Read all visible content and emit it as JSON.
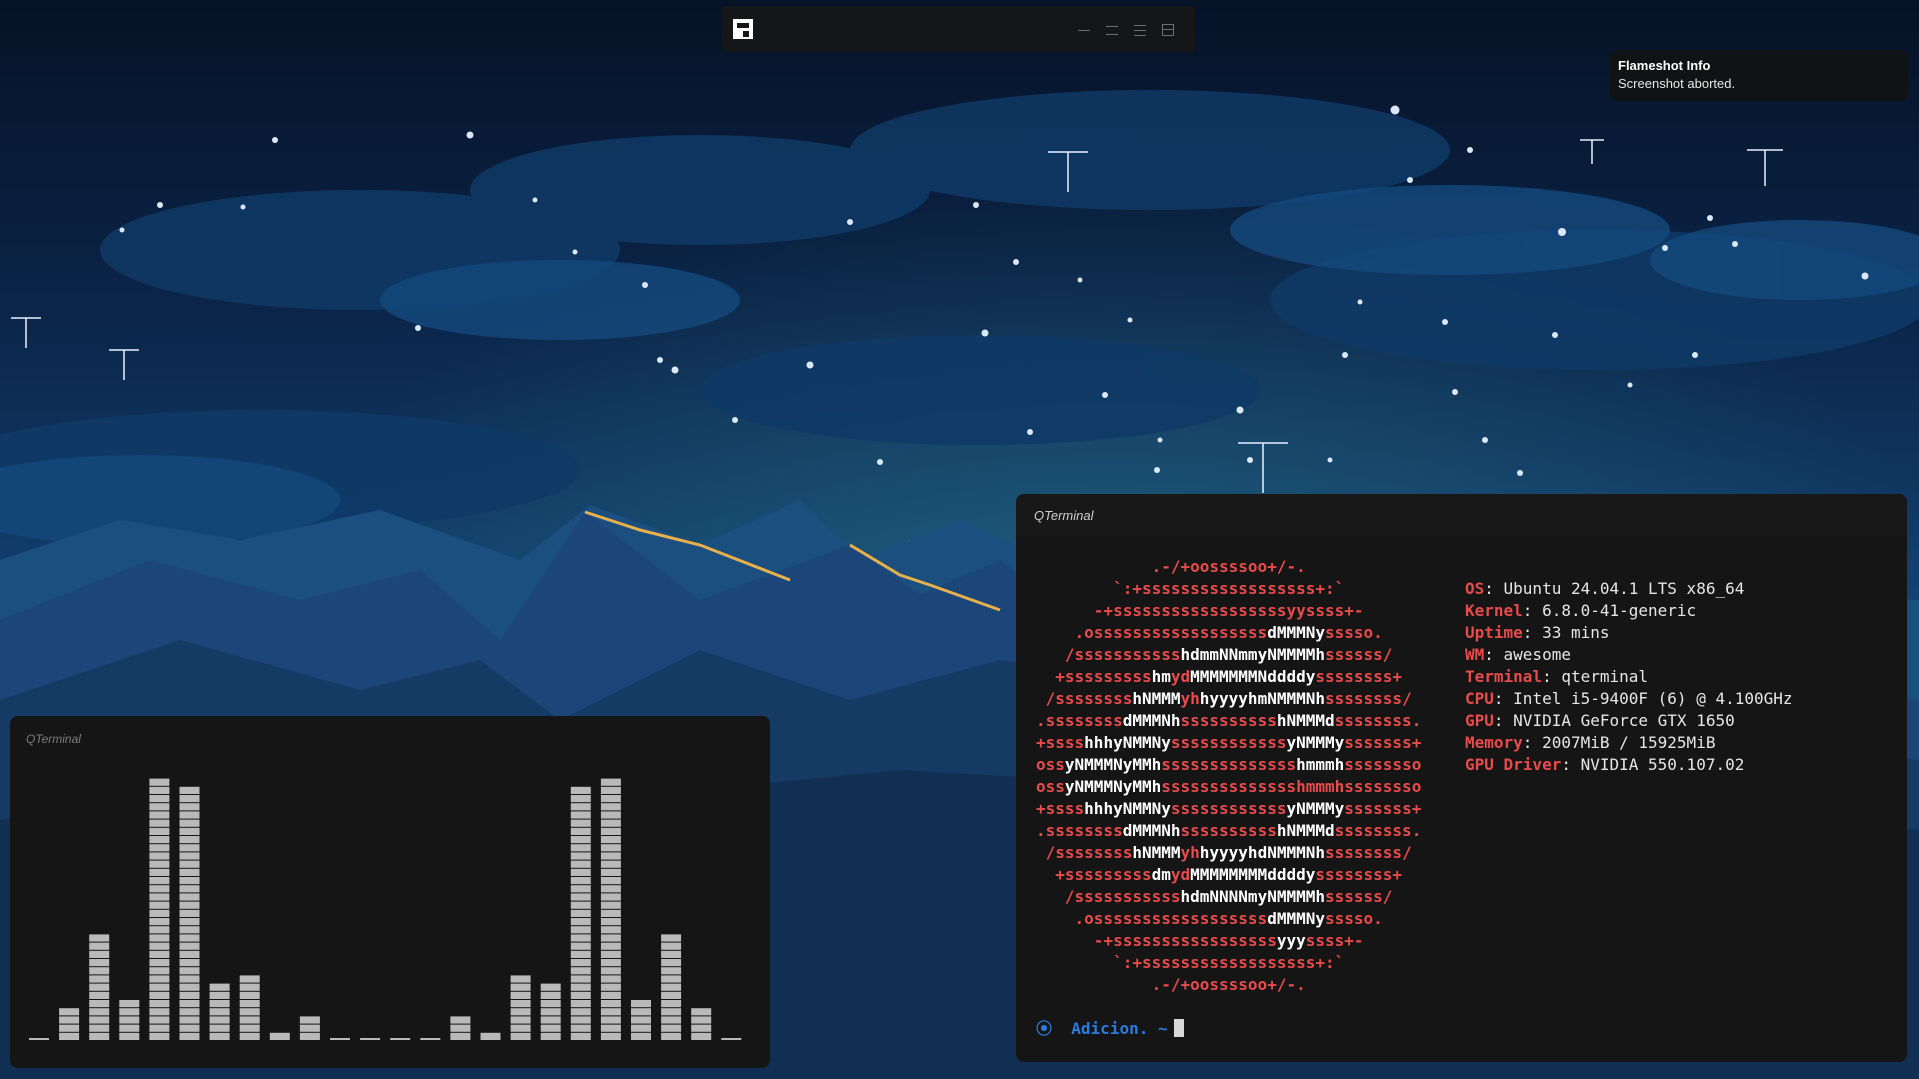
{
  "desktop": {
    "wallpaper": "night-sky-mountains",
    "colors": {
      "sky_top": "#061226",
      "sky_mid": "#12406e",
      "mountain": "#1c4f82",
      "ridge_glow": "#e8b04a"
    }
  },
  "wibar": {
    "launcher_icon": "awesome-launcher-icon",
    "layout_icons": [
      "tile-layout-icon",
      "fair-layout-icon",
      "max-layout-icon",
      "floating-layout-icon"
    ]
  },
  "notification": {
    "title": "Flameshot Info",
    "body": "Screenshot aborted."
  },
  "visualizer_terminal": {
    "title": "QTerminal",
    "bar_levels": [
      0,
      0.11,
      0.41,
      0.15,
      1.0,
      0.95,
      0.22,
      0.25,
      0.03,
      0.08,
      0,
      0,
      0,
      0,
      0.08,
      0.03,
      0.25,
      0.22,
      0.95,
      1.0,
      0.15,
      0.41,
      0.11,
      0
    ]
  },
  "fetch_terminal": {
    "title": "QTerminal",
    "logo": [
      [
        [
          "r",
          "            .-/+oossssoo+/-."
        ]
      ],
      [
        [
          "r",
          "        `:+ssssssssssssssssss+:`"
        ]
      ],
      [
        [
          "r",
          "      -+ssssssssssssssssssyyssss+-"
        ]
      ],
      [
        [
          "r",
          "    .ossssssssssssssssss"
        ],
        [
          "w",
          "dMMMNy"
        ],
        [
          "r",
          "sssso."
        ]
      ],
      [
        [
          "r",
          "   /sssssssssss"
        ],
        [
          "w",
          "hdmmNNmmyNMMMMh"
        ],
        [
          "r",
          "ssssss/"
        ]
      ],
      [
        [
          "r",
          "  +sssssssss"
        ],
        [
          "w",
          "hm"
        ],
        [
          "r",
          "yd"
        ],
        [
          "w",
          "MMMMMMMNddddy"
        ],
        [
          "r",
          "ssssssss+"
        ]
      ],
      [
        [
          "r",
          " /ssssssss"
        ],
        [
          "w",
          "hNMMM"
        ],
        [
          "r",
          "yh"
        ],
        [
          "w",
          "hyyyyhmNMMMNh"
        ],
        [
          "r",
          "ssssssss/"
        ]
      ],
      [
        [
          "r",
          ".ssssssss"
        ],
        [
          "w",
          "dMMMNh"
        ],
        [
          "r",
          "ssssssssss"
        ],
        [
          "w",
          "hNMMMd"
        ],
        [
          "r",
          "ssssssss."
        ]
      ],
      [
        [
          "r",
          "+ssss"
        ],
        [
          "w",
          "hhhyNMMNy"
        ],
        [
          "r",
          "ssssssssssss"
        ],
        [
          "w",
          "yNMMMy"
        ],
        [
          "r",
          "sssssss+"
        ]
      ],
      [
        [
          "r",
          "oss"
        ],
        [
          "w",
          "yNMMMNyMMh"
        ],
        [
          "r",
          "ssssssssssssss"
        ],
        [
          "w",
          "hmmmh"
        ],
        [
          "r",
          "ssssssso"
        ]
      ],
      [
        [
          "r",
          "oss"
        ],
        [
          "w",
          "yNMMMNyMMh"
        ],
        [
          "r",
          "sssssssssssssshmmmhssssssso"
        ]
      ],
      [
        [
          "r",
          "+ssss"
        ],
        [
          "w",
          "hhhyNMMNy"
        ],
        [
          "r",
          "ssssssssssss"
        ],
        [
          "w",
          "yNMMMy"
        ],
        [
          "r",
          "sssssss+"
        ]
      ],
      [
        [
          "r",
          ".ssssssss"
        ],
        [
          "w",
          "dMMMNh"
        ],
        [
          "r",
          "ssssssssss"
        ],
        [
          "w",
          "hNMMMd"
        ],
        [
          "r",
          "ssssssss."
        ]
      ],
      [
        [
          "r",
          " /ssssssss"
        ],
        [
          "w",
          "hNMMM"
        ],
        [
          "r",
          "yh"
        ],
        [
          "w",
          "hyyyyhdNMMMNh"
        ],
        [
          "r",
          "ssssssss/"
        ]
      ],
      [
        [
          "r",
          "  +sssssssss"
        ],
        [
          "w",
          "dm"
        ],
        [
          "r",
          "yd"
        ],
        [
          "w",
          "MMMMMMMMddddy"
        ],
        [
          "r",
          "ssssssss+"
        ]
      ],
      [
        [
          "r",
          "   /sssssssssss"
        ],
        [
          "w",
          "hdmNNNNmyNMMMMh"
        ],
        [
          "r",
          "ssssss/"
        ]
      ],
      [
        [
          "r",
          "    .ossssssssssssssssss"
        ],
        [
          "w",
          "dMMMNy"
        ],
        [
          "r",
          "sssso."
        ]
      ],
      [
        [
          "r",
          "      -+sssssssssssssssss"
        ],
        [
          "w",
          "yyy"
        ],
        [
          "r",
          "ssss+-"
        ]
      ],
      [
        [
          "r",
          "        `:+ssssssssssssssssss+:`"
        ]
      ],
      [
        [
          "r",
          "            .-/+oossssoo+/-."
        ]
      ]
    ],
    "info": [
      {
        "key": "OS",
        "value": "Ubuntu 24.04.1 LTS x86_64"
      },
      {
        "key": "Kernel",
        "value": "6.8.0-41-generic"
      },
      {
        "key": "Uptime",
        "value": "33 mins"
      },
      {
        "key": "WM",
        "value": "awesome"
      },
      {
        "key": "Terminal",
        "value": "qterminal"
      },
      {
        "key": "CPU",
        "value": "Intel i5-9400F (6) @ 4.100GHz"
      },
      {
        "key": "GPU",
        "value": "NVIDIA GeForce GTX 1650"
      },
      {
        "key": "Memory",
        "value": "2007MiB / 15925MiB"
      },
      {
        "key": "GPU Driver",
        "value": "NVIDIA 550.107.02"
      }
    ],
    "prompt": {
      "icon": "ubuntu-icon",
      "user": "Adicion.",
      "cwd": "~"
    },
    "colors": {
      "logo_red": "#e84b4b",
      "logo_white": "#ffffff",
      "prompt_blue": "#2a7be0"
    }
  }
}
